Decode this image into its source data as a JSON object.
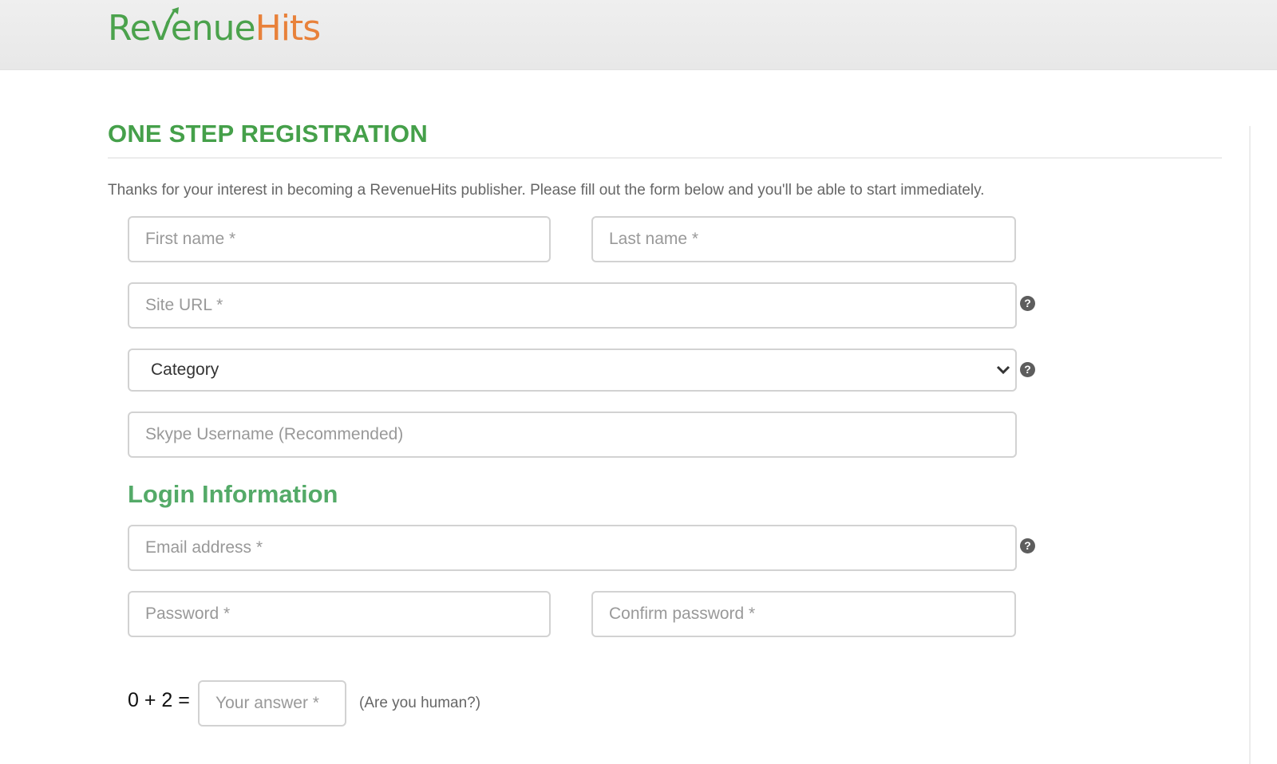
{
  "header": {
    "logo": {
      "part1": "Revenue",
      "part2": "Hits"
    },
    "colors": {
      "green": "#4ba24c",
      "orange": "#e8813a"
    }
  },
  "page": {
    "title": "ONE STEP REGISTRATION",
    "intro": "Thanks for your interest in becoming a RevenueHits publisher. Please fill out the form below and you'll be able to start immediately."
  },
  "form": {
    "first_name": {
      "placeholder": "First name *",
      "value": ""
    },
    "last_name": {
      "placeholder": "Last name *",
      "value": ""
    },
    "site_url": {
      "placeholder": "Site URL *",
      "value": "",
      "help_icon": "question-circle-icon",
      "help_glyph": "?"
    },
    "category": {
      "selected": "Category",
      "help_icon": "question-circle-icon",
      "help_glyph": "?"
    },
    "skype": {
      "placeholder": "Skype Username (Recommended)",
      "value": ""
    },
    "login_section_title": "Login Information",
    "email": {
      "placeholder": "Email address *",
      "value": "",
      "help_icon": "question-circle-icon",
      "help_glyph": "?"
    },
    "password": {
      "placeholder": "Password *",
      "value": ""
    },
    "confirm_password": {
      "placeholder": "Confirm password *",
      "value": ""
    },
    "captcha": {
      "question": "0 + 2 =",
      "placeholder": "Your answer *",
      "value": "",
      "note": "(Are you human?)"
    }
  }
}
